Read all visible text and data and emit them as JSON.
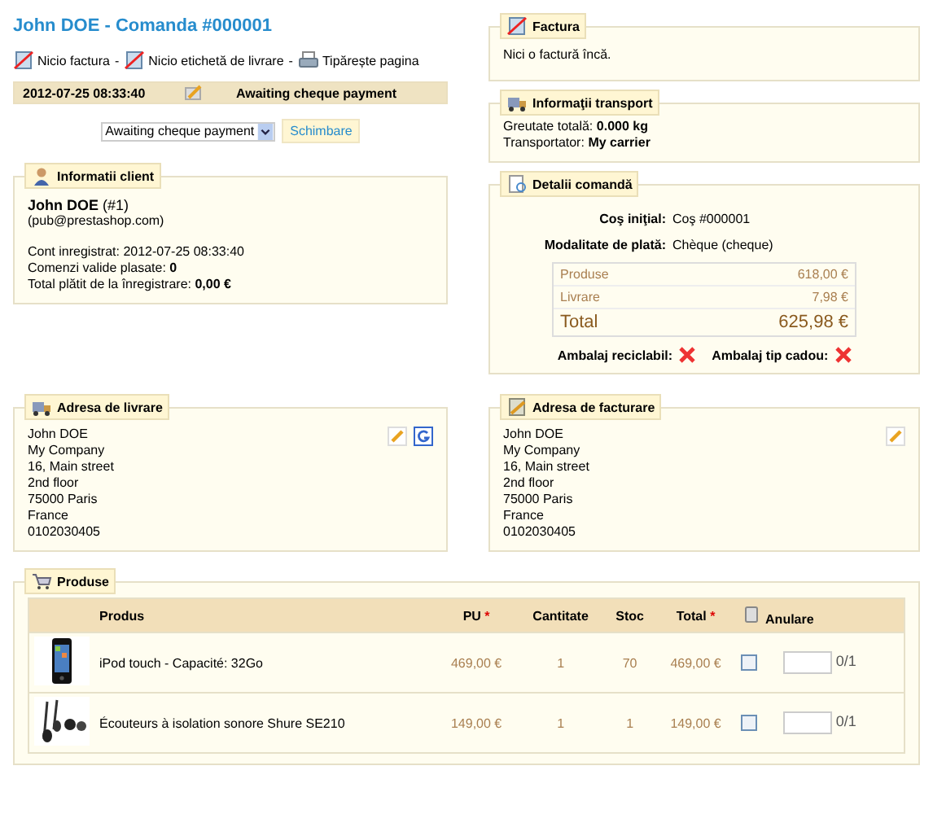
{
  "title": "John DOE - Comanda #000001",
  "actions": [
    {
      "kind": "no-invoice",
      "label": "Nicio factura"
    },
    {
      "kind": "no-slip",
      "label": "Nicio etichetă de livrare"
    },
    {
      "kind": "print",
      "label": "Tipărește pagina"
    }
  ],
  "action_separator": "-",
  "status_history": [
    {
      "date": "2012-07-25 08:33:40",
      "status": "Awaiting cheque payment"
    }
  ],
  "status_select": {
    "value": "Awaiting cheque payment",
    "button": "Schimbare"
  },
  "client": {
    "legend": "Informatii client",
    "name": "**John DOE** (#1)",
    "email": "(pub@prestashop.com)",
    "lines": [
      "Cont inregistrat: 2012-07-25 08:33:40",
      "Comenzi valide plasate: **0**",
      "Total plătit de la înregistrare: **0,00 €**"
    ]
  },
  "invoice": {
    "legend": "Factura",
    "text": "Nici o factură încă."
  },
  "shipping": {
    "legend": "Informaţii transport",
    "lines": [
      {
        "label": "Greutate totală:",
        "value": "0.000 kg"
      },
      {
        "label": "Transportator:",
        "value": "My carrier"
      }
    ]
  },
  "details": {
    "legend": "Detalii comandă",
    "fields": [
      {
        "label": "Coş iniţial:",
        "value": "Coş #000001"
      },
      {
        "label": "Modalitate de plată:",
        "value": "Chèque (cheque)"
      }
    ],
    "totals": [
      {
        "label": "Produse",
        "value": "618,00 €",
        "grand": false
      },
      {
        "label": "Livrare",
        "value": "7,98 €",
        "grand": false
      },
      {
        "label": "Total",
        "value": "625,98 €",
        "grand": true
      }
    ],
    "flags": [
      {
        "label": "Ambalaj reciclabil:",
        "checked": false
      },
      {
        "label": "Ambalaj tip cadou:",
        "checked": false
      }
    ]
  },
  "addresses": [
    {
      "legend": "Adresa de livrare",
      "kind": "delivery",
      "map": true,
      "lines": [
        "John DOE",
        "My Company",
        "16, Main street",
        "2nd floor",
        "75000 Paris",
        "France",
        "0102030405"
      ]
    },
    {
      "legend": "Adresa de facturare",
      "kind": "invoice",
      "map": false,
      "lines": [
        "John DOE",
        "My Company",
        "16, Main street",
        "2nd floor",
        "75000 Paris",
        "France",
        "0102030405"
      ]
    }
  ],
  "products": {
    "legend": "Produse",
    "columns": [
      {
        "label": "Produs"
      },
      {
        "label": "PU",
        "note": "*"
      },
      {
        "label": "Cantitate"
      },
      {
        "label": "Stoc"
      },
      {
        "label": "Total",
        "note": "*"
      },
      {
        "label": "Anulare"
      }
    ],
    "rows": [
      {
        "kind": "phone",
        "name": "iPod touch - Capacité: 32Go",
        "price": "469,00 €",
        "qty": "1",
        "stock": "70",
        "total": "469,00 €",
        "checked": false,
        "refund": "0/1"
      },
      {
        "kind": "earphones",
        "name": "Écouteurs à isolation sonore Shure SE210",
        "price": "149,00 €",
        "qty": "1",
        "stock": "1",
        "total": "149,00 €",
        "checked": false,
        "refund": "0/1"
      }
    ]
  }
}
